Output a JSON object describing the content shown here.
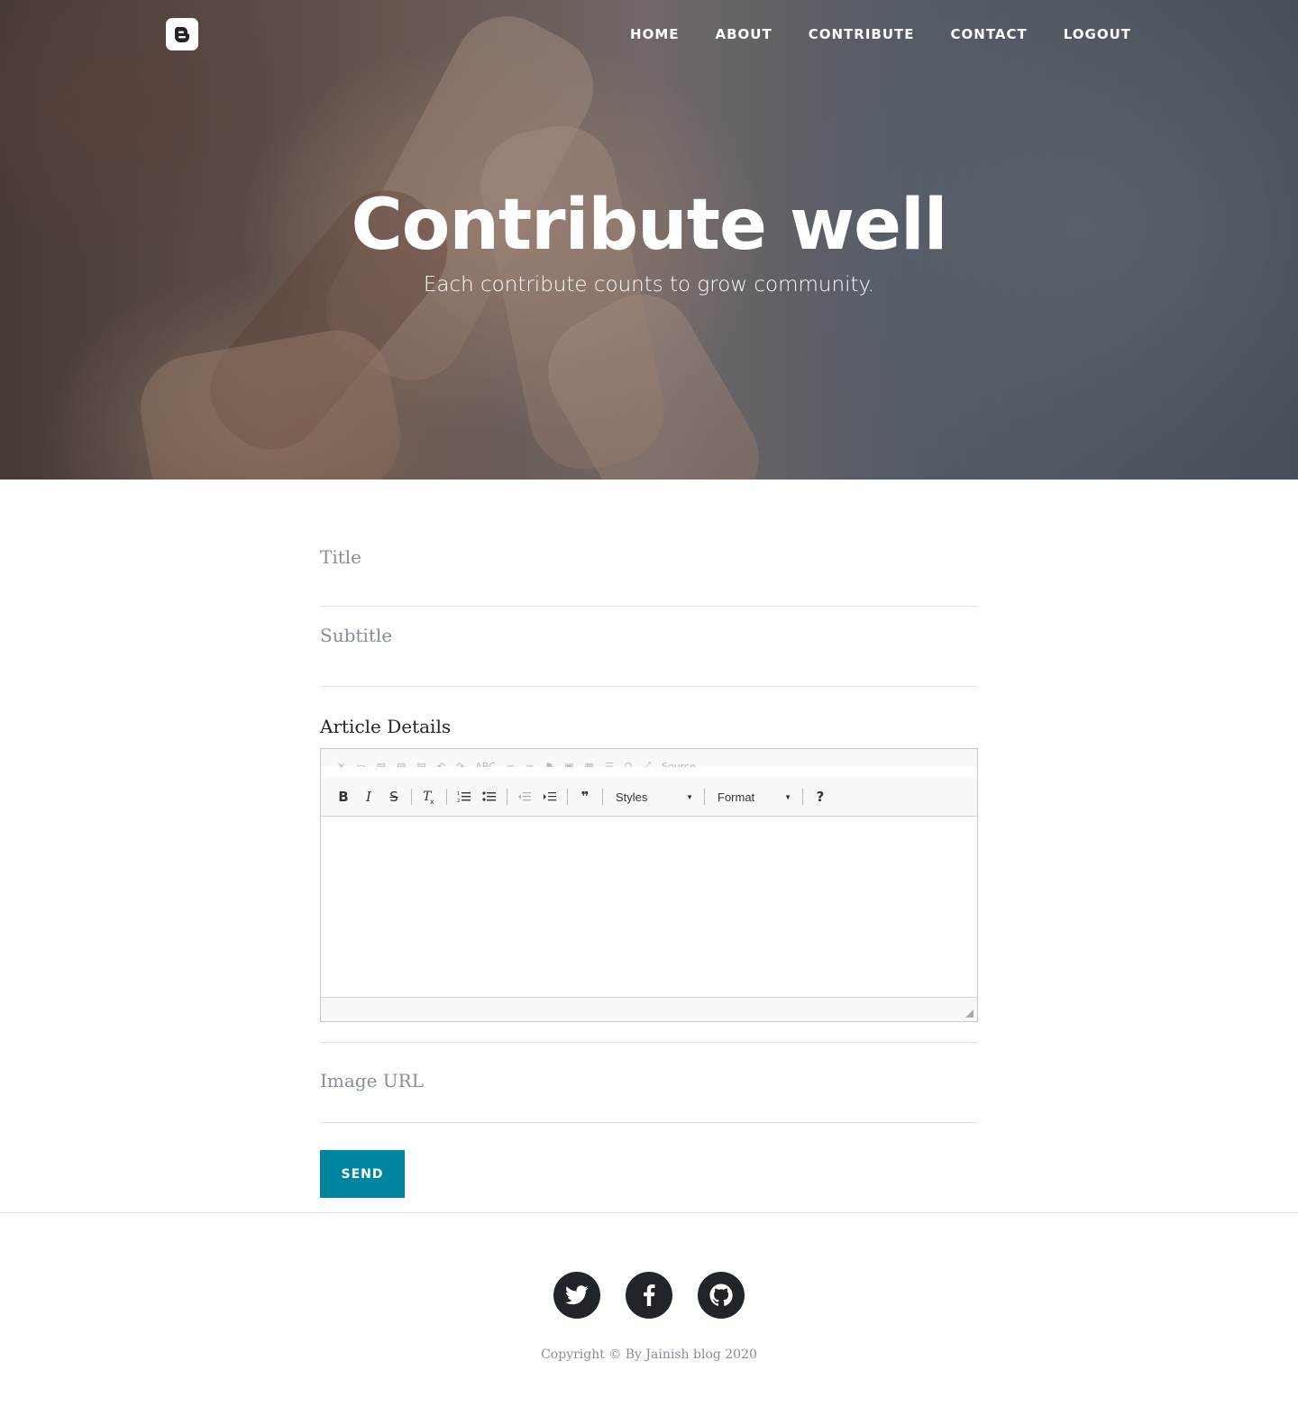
{
  "nav": {
    "brand_icon": "blogger-icon",
    "items": [
      {
        "label": "HOME"
      },
      {
        "label": "ABOUT"
      },
      {
        "label": "CONTRIBUTE"
      },
      {
        "label": "CONTACT"
      },
      {
        "label": "LOGOUT"
      }
    ]
  },
  "hero": {
    "title": "Contribute well",
    "subtitle": "Each contribute counts to grow community."
  },
  "form": {
    "title_placeholder": "Title",
    "subtitle_placeholder": "Subtitle",
    "details_label": "Article Details",
    "editor": {
      "top_toolbar_partial": [
        "ABC",
        "Source"
      ],
      "styles_label": "Styles",
      "format_label": "Format",
      "help_label": "?"
    },
    "image_url_placeholder": "Image URL",
    "send_label": "SEND"
  },
  "footer": {
    "social_icons": [
      "twitter-icon",
      "facebook-icon",
      "github-icon"
    ],
    "copyright": "Copyright © By Jainish blog 2020"
  },
  "colors": {
    "accent": "#0085a1",
    "dark": "#212529",
    "muted": "#868e96"
  }
}
